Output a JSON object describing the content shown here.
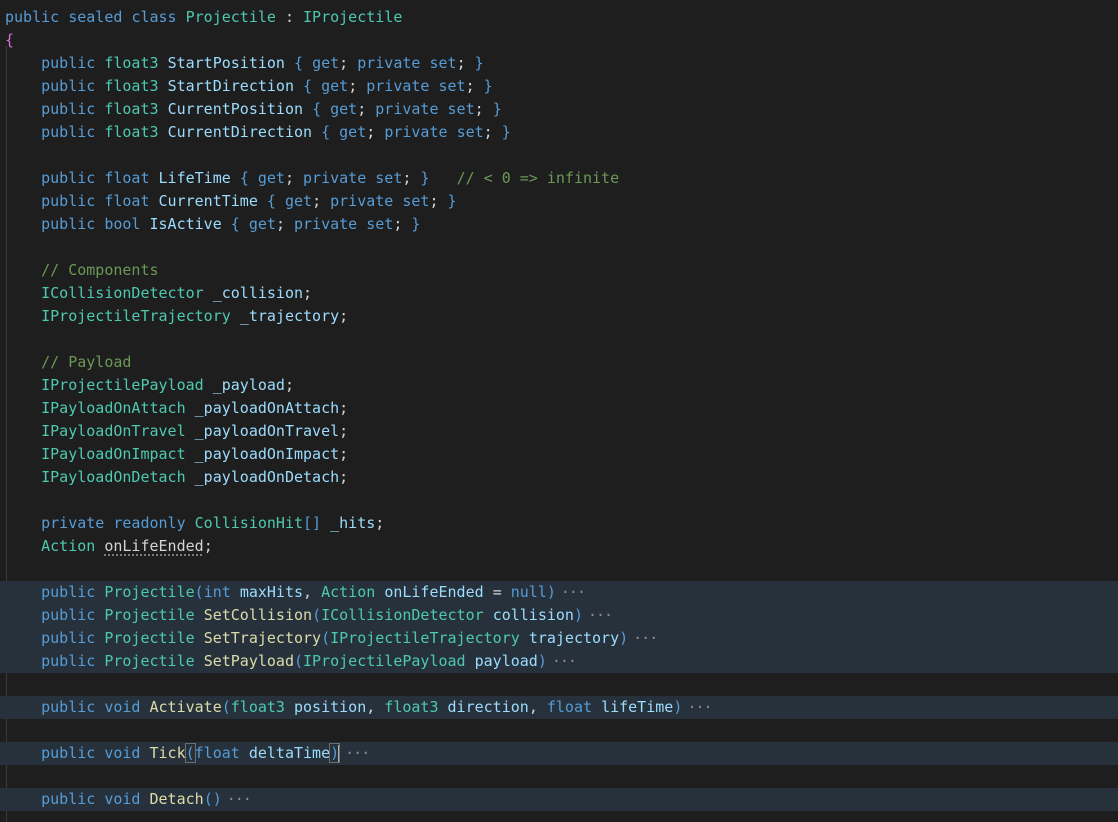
{
  "editor": {
    "language": "csharp",
    "theme_colors": {
      "background": "#1e1e1e",
      "highlight": "#26313b",
      "keyword": "#569cd6",
      "type": "#4ec9b0",
      "function": "#dcdcaa",
      "identifier": "#9cdcfe",
      "comment": "#6a9955",
      "brace": "#da70d6",
      "plain": "#d4d4d4"
    },
    "lines": [
      {
        "tokens": [
          [
            "kw",
            "public "
          ],
          [
            "kw",
            "sealed "
          ],
          [
            "kw",
            "class "
          ],
          [
            "ty",
            "Projectile"
          ],
          [
            "pl",
            " : "
          ],
          [
            "ty",
            "IProjectile"
          ]
        ]
      },
      {
        "tokens": [
          [
            "br",
            "{"
          ]
        ]
      },
      {
        "tokens": [
          [
            "pl",
            "    "
          ],
          [
            "kw",
            "public "
          ],
          [
            "ty",
            "float3 "
          ],
          [
            "id",
            "StartPosition "
          ],
          [
            "kw",
            "{ "
          ],
          [
            "kw",
            "get"
          ],
          [
            "pl",
            "; "
          ],
          [
            "kw",
            "private "
          ],
          [
            "kw",
            "set"
          ],
          [
            "pl",
            "; "
          ],
          [
            "kw",
            "}"
          ]
        ]
      },
      {
        "tokens": [
          [
            "pl",
            "    "
          ],
          [
            "kw",
            "public "
          ],
          [
            "ty",
            "float3 "
          ],
          [
            "id",
            "StartDirection "
          ],
          [
            "kw",
            "{ "
          ],
          [
            "kw",
            "get"
          ],
          [
            "pl",
            "; "
          ],
          [
            "kw",
            "private "
          ],
          [
            "kw",
            "set"
          ],
          [
            "pl",
            "; "
          ],
          [
            "kw",
            "}"
          ]
        ]
      },
      {
        "tokens": [
          [
            "pl",
            "    "
          ],
          [
            "kw",
            "public "
          ],
          [
            "ty",
            "float3 "
          ],
          [
            "id",
            "CurrentPosition "
          ],
          [
            "kw",
            "{ "
          ],
          [
            "kw",
            "get"
          ],
          [
            "pl",
            "; "
          ],
          [
            "kw",
            "private "
          ],
          [
            "kw",
            "set"
          ],
          [
            "pl",
            "; "
          ],
          [
            "kw",
            "}"
          ]
        ]
      },
      {
        "tokens": [
          [
            "pl",
            "    "
          ],
          [
            "kw",
            "public "
          ],
          [
            "ty",
            "float3 "
          ],
          [
            "id",
            "CurrentDirection "
          ],
          [
            "kw",
            "{ "
          ],
          [
            "kw",
            "get"
          ],
          [
            "pl",
            "; "
          ],
          [
            "kw",
            "private "
          ],
          [
            "kw",
            "set"
          ],
          [
            "pl",
            "; "
          ],
          [
            "kw",
            "}"
          ]
        ]
      },
      {
        "tokens": []
      },
      {
        "tokens": [
          [
            "pl",
            "    "
          ],
          [
            "kw",
            "public "
          ],
          [
            "kw",
            "float "
          ],
          [
            "id",
            "LifeTime "
          ],
          [
            "kw",
            "{ "
          ],
          [
            "kw",
            "get"
          ],
          [
            "pl",
            "; "
          ],
          [
            "kw",
            "private "
          ],
          [
            "kw",
            "set"
          ],
          [
            "pl",
            "; "
          ],
          [
            "kw",
            "}"
          ],
          [
            "pl",
            "   "
          ],
          [
            "cm",
            "// < 0 => infinite"
          ]
        ]
      },
      {
        "tokens": [
          [
            "pl",
            "    "
          ],
          [
            "kw",
            "public "
          ],
          [
            "kw",
            "float "
          ],
          [
            "id",
            "CurrentTime "
          ],
          [
            "kw",
            "{ "
          ],
          [
            "kw",
            "get"
          ],
          [
            "pl",
            "; "
          ],
          [
            "kw",
            "private "
          ],
          [
            "kw",
            "set"
          ],
          [
            "pl",
            "; "
          ],
          [
            "kw",
            "}"
          ]
        ]
      },
      {
        "tokens": [
          [
            "pl",
            "    "
          ],
          [
            "kw",
            "public "
          ],
          [
            "kw",
            "bool "
          ],
          [
            "id",
            "IsActive "
          ],
          [
            "kw",
            "{ "
          ],
          [
            "kw",
            "get"
          ],
          [
            "pl",
            "; "
          ],
          [
            "kw",
            "private "
          ],
          [
            "kw",
            "set"
          ],
          [
            "pl",
            "; "
          ],
          [
            "kw",
            "}"
          ]
        ]
      },
      {
        "tokens": []
      },
      {
        "tokens": [
          [
            "pl",
            "    "
          ],
          [
            "cm",
            "// Components"
          ]
        ]
      },
      {
        "tokens": [
          [
            "pl",
            "    "
          ],
          [
            "ty",
            "ICollisionDetector "
          ],
          [
            "id",
            "_collision"
          ],
          [
            "pl",
            ";"
          ]
        ]
      },
      {
        "tokens": [
          [
            "pl",
            "    "
          ],
          [
            "ty",
            "IProjectileTrajectory "
          ],
          [
            "id",
            "_trajectory"
          ],
          [
            "pl",
            ";"
          ]
        ]
      },
      {
        "tokens": []
      },
      {
        "tokens": [
          [
            "pl",
            "    "
          ],
          [
            "cm",
            "// Payload"
          ]
        ]
      },
      {
        "tokens": [
          [
            "pl",
            "    "
          ],
          [
            "ty",
            "IProjectilePayload "
          ],
          [
            "id",
            "_payload"
          ],
          [
            "pl",
            ";"
          ]
        ]
      },
      {
        "tokens": [
          [
            "pl",
            "    "
          ],
          [
            "ty",
            "IPayloadOnAttach "
          ],
          [
            "id",
            "_payloadOnAttach"
          ],
          [
            "pl",
            ";"
          ]
        ]
      },
      {
        "tokens": [
          [
            "pl",
            "    "
          ],
          [
            "ty",
            "IPayloadOnTravel "
          ],
          [
            "id",
            "_payloadOnTravel"
          ],
          [
            "pl",
            ";"
          ]
        ]
      },
      {
        "tokens": [
          [
            "pl",
            "    "
          ],
          [
            "ty",
            "IPayloadOnImpact "
          ],
          [
            "id",
            "_payloadOnImpact"
          ],
          [
            "pl",
            ";"
          ]
        ]
      },
      {
        "tokens": [
          [
            "pl",
            "    "
          ],
          [
            "ty",
            "IPayloadOnDetach "
          ],
          [
            "id",
            "_payloadOnDetach"
          ],
          [
            "pl",
            ";"
          ]
        ]
      },
      {
        "tokens": []
      },
      {
        "tokens": [
          [
            "pl",
            "    "
          ],
          [
            "kw",
            "private "
          ],
          [
            "kw",
            "readonly "
          ],
          [
            "ty",
            "CollisionHit"
          ],
          [
            "kw",
            "[]"
          ],
          [
            "pl",
            " "
          ],
          [
            "id",
            "_hits"
          ],
          [
            "pl",
            ";"
          ]
        ]
      },
      {
        "tokens": [
          [
            "pl",
            "    "
          ],
          [
            "ty",
            "Action "
          ],
          [
            "dot",
            "onLifeEnded"
          ],
          [
            "pl",
            ";"
          ]
        ]
      },
      {
        "tokens": []
      },
      {
        "hl": true,
        "fold": true,
        "tokens": [
          [
            "pl",
            "    "
          ],
          [
            "kw",
            "public "
          ],
          [
            "ty",
            "Projectile"
          ],
          [
            "kw",
            "("
          ],
          [
            "kw",
            "int "
          ],
          [
            "prm",
            "maxHits"
          ],
          [
            "pl",
            ", "
          ],
          [
            "ty",
            "Action "
          ],
          [
            "prm",
            "onLifeEnded "
          ],
          [
            "pl",
            "= "
          ],
          [
            "kw",
            "null"
          ],
          [
            "kw",
            ")"
          ]
        ]
      },
      {
        "hl": true,
        "fold": true,
        "tokens": [
          [
            "pl",
            "    "
          ],
          [
            "kw",
            "public "
          ],
          [
            "ty",
            "Projectile "
          ],
          [
            "fn",
            "SetCollision"
          ],
          [
            "kw",
            "("
          ],
          [
            "ty",
            "ICollisionDetector "
          ],
          [
            "prm",
            "collision"
          ],
          [
            "kw",
            ")"
          ]
        ]
      },
      {
        "hl": true,
        "fold": true,
        "tokens": [
          [
            "pl",
            "    "
          ],
          [
            "kw",
            "public "
          ],
          [
            "ty",
            "Projectile "
          ],
          [
            "fn",
            "SetTrajectory"
          ],
          [
            "kw",
            "("
          ],
          [
            "ty",
            "IProjectileTrajectory "
          ],
          [
            "prm",
            "trajectory"
          ],
          [
            "kw",
            ")"
          ]
        ]
      },
      {
        "hl": true,
        "fold": true,
        "tokens": [
          [
            "pl",
            "    "
          ],
          [
            "kw",
            "public "
          ],
          [
            "ty",
            "Projectile "
          ],
          [
            "fn",
            "SetPayload"
          ],
          [
            "kw",
            "("
          ],
          [
            "ty",
            "IProjectilePayload "
          ],
          [
            "prm",
            "payload"
          ],
          [
            "kw",
            ")"
          ]
        ]
      },
      {
        "tokens": []
      },
      {
        "hl": true,
        "fold": true,
        "tokens": [
          [
            "pl",
            "    "
          ],
          [
            "kw",
            "public "
          ],
          [
            "kw",
            "void "
          ],
          [
            "fn",
            "Activate"
          ],
          [
            "kw",
            "("
          ],
          [
            "ty",
            "float3 "
          ],
          [
            "prm",
            "position"
          ],
          [
            "pl",
            ", "
          ],
          [
            "ty",
            "float3 "
          ],
          [
            "prm",
            "direction"
          ],
          [
            "pl",
            ", "
          ],
          [
            "kw",
            "float "
          ],
          [
            "prm",
            "lifeTime"
          ],
          [
            "kw",
            ")"
          ]
        ]
      },
      {
        "tokens": []
      },
      {
        "hl": true,
        "fold": true,
        "cursor": true,
        "tokens": [
          [
            "pl",
            "    "
          ],
          [
            "kw",
            "public "
          ],
          [
            "kw",
            "void "
          ],
          [
            "fn",
            "Tick"
          ],
          [
            "bm",
            "("
          ],
          [
            "kw",
            "float "
          ],
          [
            "prm",
            "deltaTime"
          ],
          [
            "bm",
            ")"
          ]
        ]
      },
      {
        "tokens": []
      },
      {
        "hl": true,
        "fold": true,
        "tokens": [
          [
            "pl",
            "    "
          ],
          [
            "kw",
            "public "
          ],
          [
            "kw",
            "void "
          ],
          [
            "fn",
            "Detach"
          ],
          [
            "kw",
            "()"
          ]
        ]
      }
    ],
    "fold_marker": "···"
  }
}
